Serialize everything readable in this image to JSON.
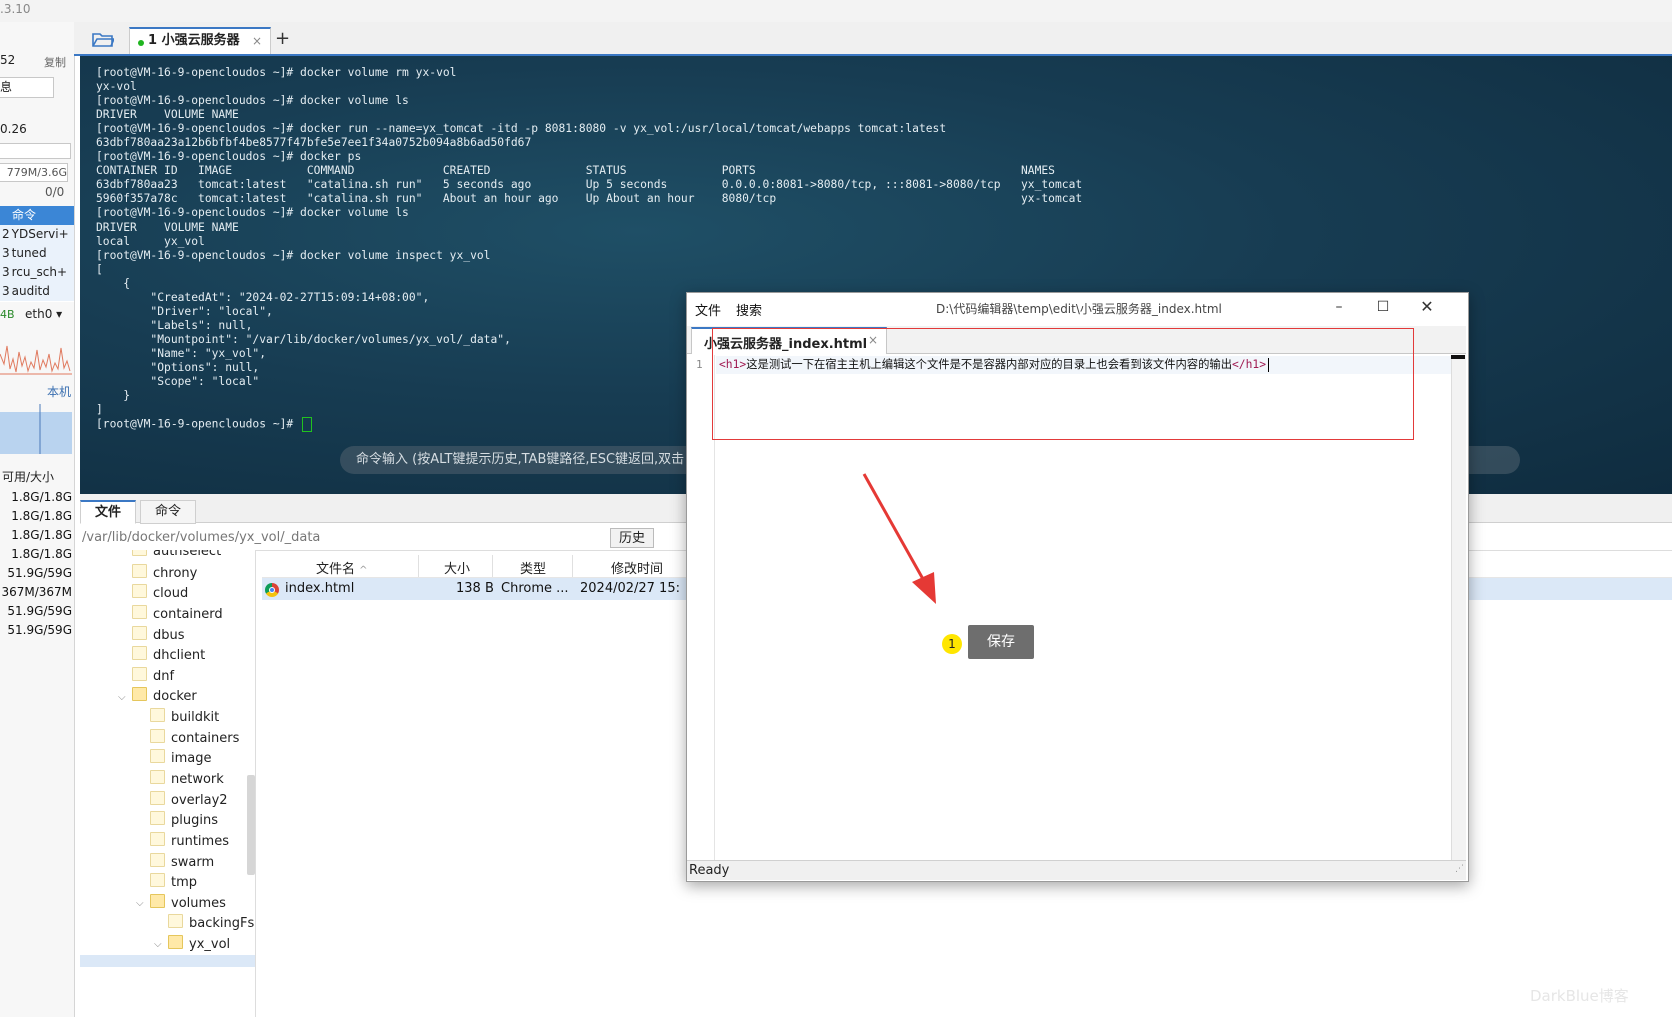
{
  "app": {
    "version_fragment": ".3.10"
  },
  "sidebar": {
    "value_top": "52",
    "copy_label": "复制",
    "info_box": "息",
    "load": "0.26",
    "mem": "779M/3.6G",
    "swap": "0/0",
    "proc_header": "命令",
    "processes": [
      {
        "num": "2",
        "name": "YDServi+"
      },
      {
        "num": "3",
        "name": "tuned"
      },
      {
        "num": "3",
        "name": "rcu_sch+"
      },
      {
        "num": "3",
        "name": "auditd"
      }
    ],
    "net_rate": "4B",
    "net_iface": "eth0",
    "local_label": "本机",
    "disk_header": "可用/大小",
    "disks": [
      "1.8G/1.8G",
      "1.8G/1.8G",
      "1.8G/1.8G",
      "1.8G/1.8G",
      "51.9G/59G",
      "367M/367M",
      "51.9G/59G",
      "51.9G/59G"
    ]
  },
  "tabs": {
    "active_label": "1 小强云服务器",
    "close": "×",
    "add": "+"
  },
  "terminal": {
    "lines": [
      "[root@VM-16-9-opencloudos ~]# docker volume rm yx-vol",
      "yx-vol",
      "[root@VM-16-9-opencloudos ~]# docker volume ls",
      "DRIVER    VOLUME NAME",
      "[root@VM-16-9-opencloudos ~]# docker run --name=yx_tomcat -itd -p 8081:8080 -v yx_vol:/usr/local/tomcat/webapps tomcat:latest",
      "63dbf780aa23a12b6bfbf4be8577f47bfe5e7ee1f34a0752b094a8b6ad50fd67",
      "[root@VM-16-9-opencloudos ~]# docker ps",
      "CONTAINER ID   IMAGE           COMMAND             CREATED              STATUS              PORTS                                       NAMES",
      "63dbf780aa23   tomcat:latest   \"catalina.sh run\"   5 seconds ago        Up 5 seconds        0.0.0.0:8081->8080/tcp, :::8081->8080/tcp   yx_tomcat",
      "5960f357a78c   tomcat:latest   \"catalina.sh run\"   About an hour ago    Up About an hour    8080/tcp                                    yx-tomcat",
      "[root@VM-16-9-opencloudos ~]# docker volume ls",
      "DRIVER    VOLUME NAME",
      "local     yx_vol",
      "[root@VM-16-9-opencloudos ~]# docker volume inspect yx_vol",
      "[",
      "    {",
      "        \"CreatedAt\": \"2024-02-27T15:09:14+08:00\",",
      "        \"Driver\": \"local\",",
      "        \"Labels\": null,",
      "        \"Mountpoint\": \"/var/lib/docker/volumes/yx_vol/_data\",",
      "        \"Name\": \"yx_vol\",",
      "        \"Options\": null,",
      "        \"Scope\": \"local\"",
      "    }",
      "]"
    ],
    "prompt": "[root@VM-16-9-opencloudos ~]# ",
    "cmd_placeholder": "命令输入 (按ALT键提示历史,TAB键路径,ESC键返回,双击"
  },
  "bottom": {
    "tab_file": "文件",
    "tab_cmd": "命令",
    "path": "/var/lib/docker/volumes/yx_vol/_data",
    "history": "历史",
    "tree": [
      {
        "name": "authselect",
        "level": 1
      },
      {
        "name": "chrony",
        "level": 1
      },
      {
        "name": "cloud",
        "level": 1
      },
      {
        "name": "containerd",
        "level": 1
      },
      {
        "name": "dbus",
        "level": 1
      },
      {
        "name": "dhclient",
        "level": 1
      },
      {
        "name": "dnf",
        "level": 1
      },
      {
        "name": "docker",
        "level": 1,
        "open": true
      },
      {
        "name": "buildkit",
        "level": 2
      },
      {
        "name": "containers",
        "level": 2
      },
      {
        "name": "image",
        "level": 2
      },
      {
        "name": "network",
        "level": 2
      },
      {
        "name": "overlay2",
        "level": 2
      },
      {
        "name": "plugins",
        "level": 2
      },
      {
        "name": "runtimes",
        "level": 2
      },
      {
        "name": "swarm",
        "level": 2
      },
      {
        "name": "tmp",
        "level": 2
      },
      {
        "name": "volumes",
        "level": 2,
        "open": true
      },
      {
        "name": "backingFs",
        "level": 3
      },
      {
        "name": "yx_vol",
        "level": 3,
        "open": true
      }
    ],
    "columns": [
      "文件名",
      "大小",
      "类型",
      "修改时间"
    ],
    "file": {
      "name": "index.html",
      "size": "138 B",
      "type": "Chrome ...",
      "mtime": "2024/02/27 15:"
    }
  },
  "editor": {
    "menu": [
      "文件",
      "搜索"
    ],
    "path": "D:\\代码编辑器\\temp\\edit\\小强云服务器_index.html",
    "tab": "小强云服务器_index.html",
    "line_number": "1",
    "code_open": "<h1>",
    "code_text": "这是测试一下在宿主主机上编辑这个文件是不是容器内部对应的目录上也会看到该文件内容的输出",
    "code_close": "</h1>",
    "status": "Ready"
  },
  "annotation": {
    "badge": "1",
    "tooltip": "保存"
  },
  "watermark": "DarkBlue博客",
  "colors": {
    "accent": "#3b78c4",
    "annotation_red": "#e23a3a",
    "badge_yellow": "#ffe600"
  }
}
